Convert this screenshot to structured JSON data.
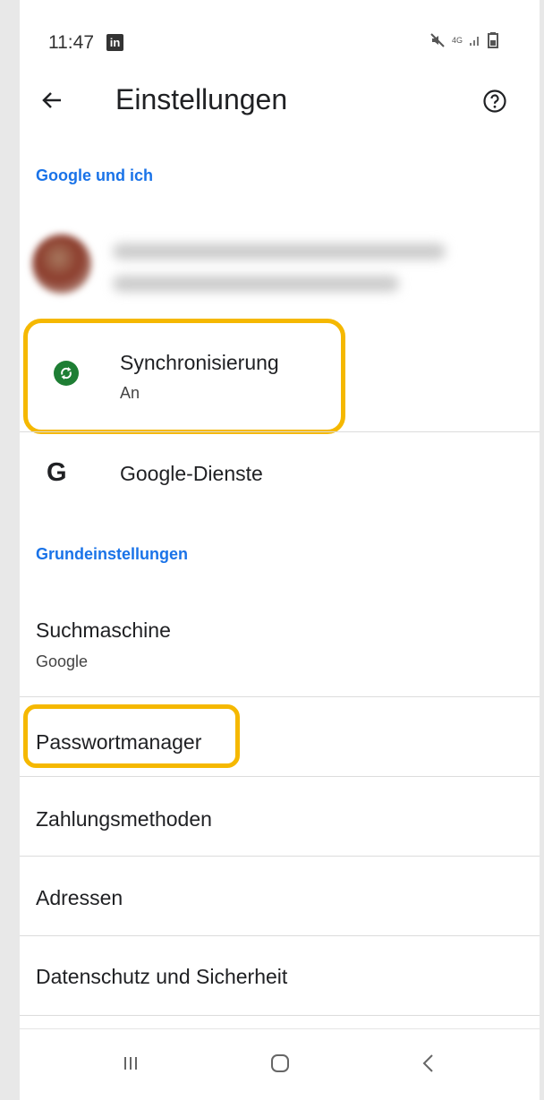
{
  "status_bar": {
    "time": "11:47",
    "app_badge": "in",
    "network_label": "4G"
  },
  "app_bar": {
    "title": "Einstellungen"
  },
  "sections": {
    "google_und_ich": "Google und ich",
    "grundeinstellungen": "Grundeinstellungen"
  },
  "items": {
    "sync": {
      "title": "Synchronisierung",
      "subtitle": "An"
    },
    "google_services": {
      "title": "Google-Dienste",
      "icon_glyph": "G"
    },
    "search_engine": {
      "title": "Suchmaschine",
      "subtitle": "Google"
    },
    "password_manager": {
      "title": "Passwortmanager"
    },
    "payment_methods": {
      "title": "Zahlungsmethoden"
    },
    "addresses": {
      "title": "Adressen"
    },
    "privacy_security": {
      "title": "Datenschutz und Sicherheit"
    }
  },
  "icons": {
    "back": "arrow-left",
    "help": "help-circle",
    "sync": "sync",
    "google": "google-g",
    "nav_recents": "recents",
    "nav_home": "home",
    "nav_back": "chevron-left"
  },
  "colors": {
    "accent": "#1a73e8",
    "highlight": "#f5b800",
    "sync_green": "#1e7e34"
  }
}
